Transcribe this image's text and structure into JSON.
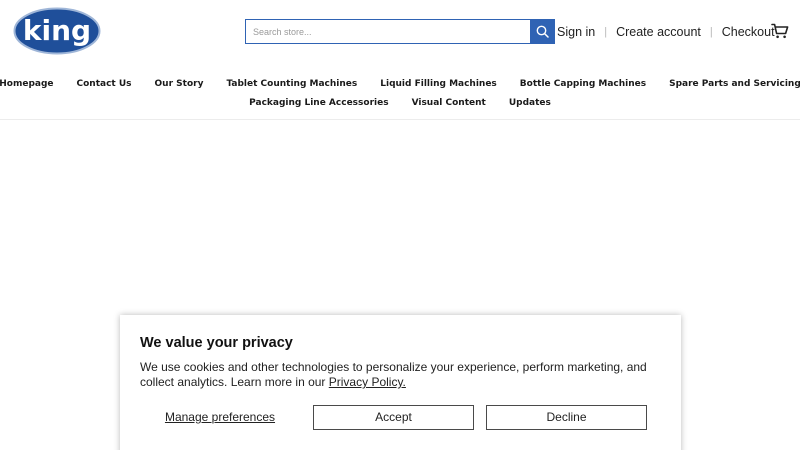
{
  "header": {
    "logo_text": "king",
    "search": {
      "placeholder": "Search store..."
    },
    "account_links": {
      "sign_in": "Sign in",
      "create_account": "Create account",
      "checkout": "Checkout",
      "separator": "|"
    }
  },
  "nav": {
    "row1": [
      "Homepage",
      "Contact Us",
      "Our Story",
      "Tablet Counting Machines",
      "Liquid Filling Machines",
      "Bottle Capping Machines",
      "Spare Parts and Servicing"
    ],
    "row2": [
      "Packaging Line Accessories",
      "Visual Content",
      "Updates"
    ]
  },
  "consent": {
    "title": "We value your privacy",
    "body": "We use cookies and other technologies to personalize your experience, perform marketing, and collect analytics. Learn more in our ",
    "policy_link": "Privacy Policy.",
    "manage_label": "Manage preferences",
    "accept_label": "Accept",
    "decline_label": "Decline"
  },
  "colors": {
    "brand_blue": "#1f4f9a",
    "search_blue": "#2f63b4"
  },
  "icons": {
    "search": "search-icon",
    "cart": "cart-icon"
  }
}
